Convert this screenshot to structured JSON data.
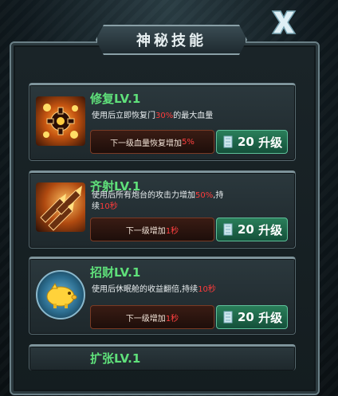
{
  "dialog": {
    "title": "神秘技能"
  },
  "skills": [
    {
      "name": "修复LV.1",
      "desc_pre": "使用后立即恢复门",
      "desc_hl": "30%",
      "desc_post": "的最大血量",
      "desc_line2": "",
      "desc_line2_hl": "",
      "next_pre": "下一级血量恢复增加",
      "next_hl": "5%",
      "cost": "20",
      "action": "升级",
      "icon": "repair-gear-icon"
    },
    {
      "name": "齐射LV.1",
      "desc_pre": "使用后所有炮台的攻击力增加",
      "desc_hl": "50%",
      "desc_post": ",持",
      "desc_line2": "续",
      "desc_line2_hl": "10秒",
      "next_pre": "下一级增加",
      "next_hl": "1秒",
      "cost": "20",
      "action": "升级",
      "icon": "volley-missile-icon"
    },
    {
      "name": "招财LV.1",
      "desc_pre": "使用后休眠舱的收益翻倍,持续",
      "desc_hl": "10秒",
      "desc_post": "",
      "desc_line2": "",
      "desc_line2_hl": "",
      "next_pre": "下一级增加",
      "next_hl": "1秒",
      "cost": "20",
      "action": "升级",
      "icon": "piggy-bank-icon"
    },
    {
      "name": "扩张LV.1"
    }
  ],
  "colors": {
    "title_green": "#5fe07a",
    "highlight_red": "#ff3b3b",
    "button_green": "#2a7f5a"
  }
}
